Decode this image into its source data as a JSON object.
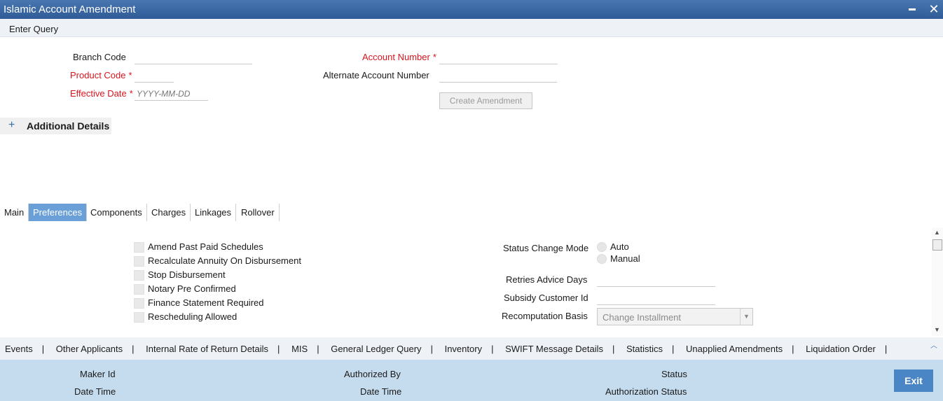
{
  "window": {
    "title": "Islamic Account Amendment"
  },
  "menu": {
    "enter_query": "Enter Query"
  },
  "form": {
    "branch_code_label": "Branch Code",
    "product_code_label": "Product Code",
    "effective_date_label": "Effective Date",
    "effective_date_placeholder": "YYYY-MM-DD",
    "account_number_label": "Account Number",
    "alternate_account_number_label": "Alternate Account Number",
    "required_mark": "*",
    "create_amendment_label": "Create Amendment"
  },
  "additional_details": {
    "plus": "+",
    "label": "Additional Details"
  },
  "tabs": [
    "Main",
    "Preferences",
    "Components",
    "Charges",
    "Linkages",
    "Rollover"
  ],
  "preferences": {
    "checkboxes": [
      "Amend Past Paid Schedules",
      "Recalculate Annuity On Disbursement",
      "Stop Disbursement",
      "Notary Pre Confirmed",
      "Finance Statement Required",
      "Rescheduling Allowed"
    ],
    "status_change_mode_label": "Status Change Mode",
    "status_change_options": [
      "Auto",
      "Manual"
    ],
    "retries_advice_days_label": "Retries Advice Days",
    "subsidy_customer_id_label": "Subsidy Customer Id",
    "recomputation_basis_label": "Recomputation Basis",
    "recomputation_basis_value": "Change Installment"
  },
  "links": [
    "Events",
    "Other Applicants",
    "Internal Rate of Return Details",
    "MIS",
    "General Ledger Query",
    "Inventory",
    "SWIFT Message Details",
    "Statistics",
    "Unapplied Amendments",
    "Liquidation Order"
  ],
  "footer": {
    "maker_id": "Maker Id",
    "date_time_1": "Date Time",
    "authorized_by": "Authorized By",
    "date_time_2": "Date Time",
    "status": "Status",
    "authorization_status": "Authorization Status",
    "exit": "Exit"
  },
  "colors": {
    "title_bar": "#2f5b96",
    "active_tab": "#6a9fd8",
    "required": "#d8141e",
    "footer": "#c5dcef",
    "exit_button": "#4a86c5"
  }
}
